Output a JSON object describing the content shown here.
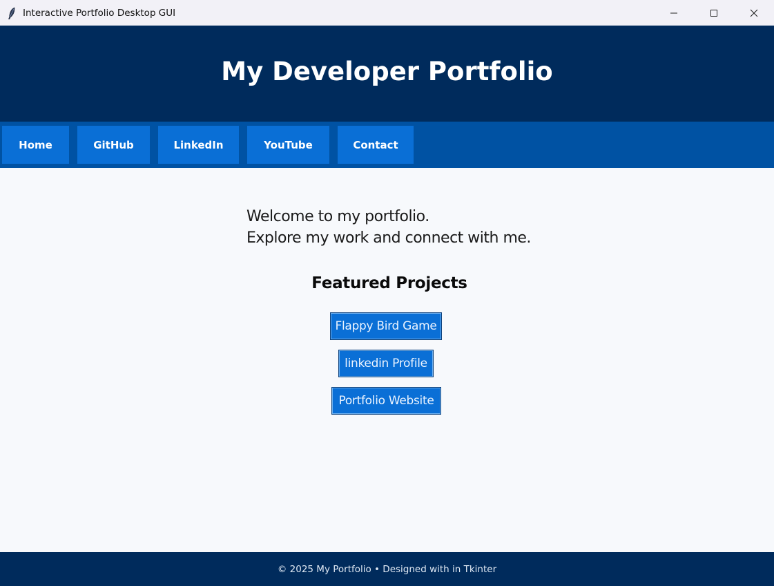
{
  "window": {
    "title": "Interactive Portfolio Desktop GUI",
    "icon": "feather-icon",
    "controls": [
      "minimize-icon",
      "maximize-icon",
      "close-icon"
    ]
  },
  "header": {
    "title": "My Developer Portfolio"
  },
  "nav": {
    "items": [
      {
        "label": "Home"
      },
      {
        "label": "GitHub"
      },
      {
        "label": "LinkedIn"
      },
      {
        "label": "YouTube"
      },
      {
        "label": "Contact"
      }
    ]
  },
  "main": {
    "intro_line1": "Welcome to my portfolio.",
    "intro_line2": "Explore my work and connect with me.",
    "featured_heading": "Featured Projects",
    "projects": [
      {
        "label": "Flappy Bird Game"
      },
      {
        "label": "linkedin Profile"
      },
      {
        "label": "Portfolio Website"
      }
    ]
  },
  "footer": {
    "text": "© 2025 My Portfolio • Designed with  in Tkinter"
  },
  "colors": {
    "header_bg": "#002b5c",
    "nav_bg": "#0052a3",
    "button_bg": "#0a6fd6",
    "page_bg": "#f7f9fc"
  }
}
